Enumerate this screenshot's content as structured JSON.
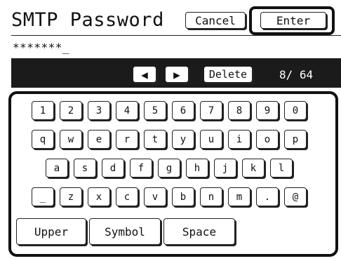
{
  "header": {
    "title": "SMTP Password",
    "cancel_label": "Cancel",
    "enter_label": "Enter"
  },
  "input": {
    "value": "*******_"
  },
  "toolbar": {
    "left_arrow": "◀",
    "right_arrow": "▶",
    "delete_label": "Delete",
    "counter": "8/ 64"
  },
  "keyboard": {
    "row1": [
      "1",
      "2",
      "3",
      "4",
      "5",
      "6",
      "7",
      "8",
      "9",
      "0"
    ],
    "row2": [
      "q",
      "w",
      "e",
      "r",
      "t",
      "y",
      "u",
      "i",
      "o",
      "p"
    ],
    "row3": [
      "a",
      "s",
      "d",
      "f",
      "g",
      "h",
      "j",
      "k",
      "l"
    ],
    "row4": [
      "_",
      "z",
      "x",
      "c",
      "v",
      "b",
      "n",
      "m",
      ".",
      "@"
    ],
    "bottom": {
      "upper_label": "Upper",
      "symbol_label": "Symbol",
      "space_label": "Space"
    }
  }
}
